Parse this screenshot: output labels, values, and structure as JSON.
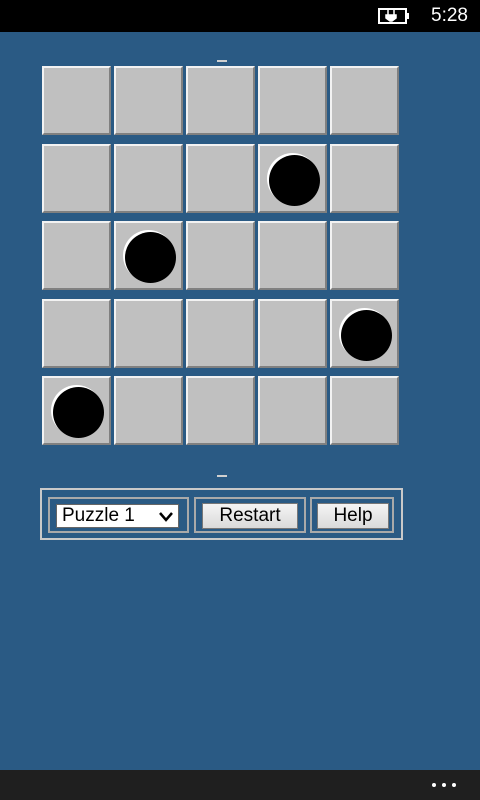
{
  "status_bar": {
    "time": "5:28",
    "battery_icon": "battery-charging-icon"
  },
  "board": {
    "rows": 5,
    "cols": 5,
    "balls": [
      {
        "row": 2,
        "col": 4
      },
      {
        "row": 3,
        "col": 2
      },
      {
        "row": 4,
        "col": 5
      },
      {
        "row": 5,
        "col": 1
      }
    ]
  },
  "toolbar": {
    "puzzle_select": {
      "value": "Puzzle 1"
    },
    "restart_label": "Restart",
    "help_label": "Help"
  },
  "app_bar": {
    "more_icon": "more-icon"
  },
  "colors": {
    "background": "#2a5a84",
    "cell": "#c0c0c0",
    "ball": "#000000"
  }
}
